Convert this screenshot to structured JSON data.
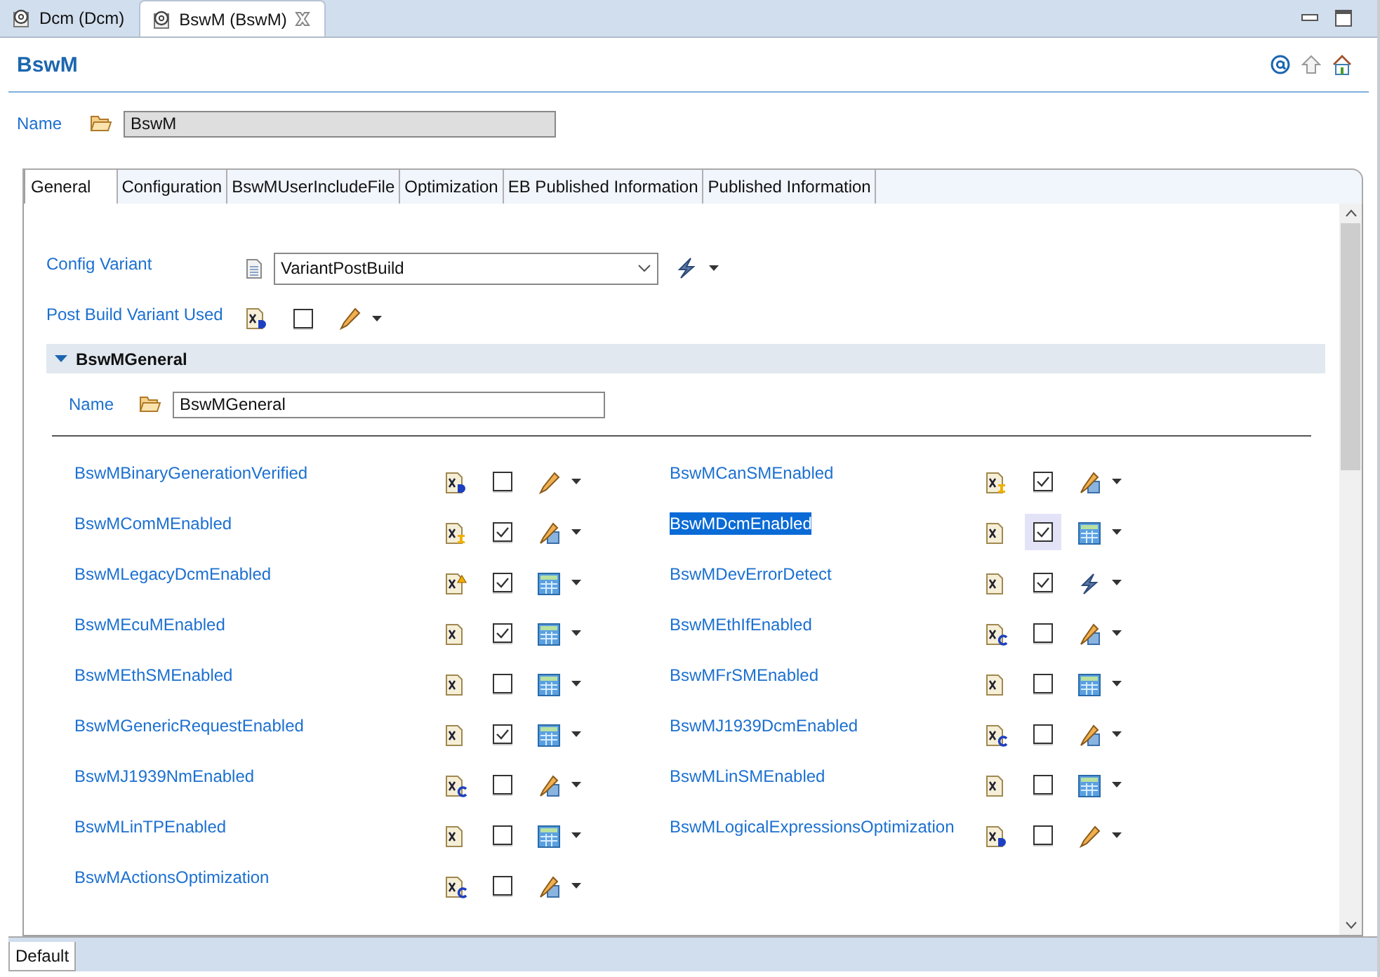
{
  "editor_tabs": [
    {
      "label": "Dcm (Dcm)",
      "selected": false,
      "closable": false
    },
    {
      "label": "BswM (BswM)",
      "selected": true,
      "closable": true
    }
  ],
  "title": "BswM",
  "name_field": {
    "label": "Name",
    "value": "BswM"
  },
  "tabs": [
    {
      "label": "General",
      "selected": true
    },
    {
      "label": "Configuration",
      "selected": false
    },
    {
      "label": "BswMUserIncludeFile",
      "selected": false
    },
    {
      "label": "Optimization",
      "selected": false
    },
    {
      "label": "EB Published Information",
      "selected": false
    },
    {
      "label": "Published Information",
      "selected": false
    }
  ],
  "config_variant": {
    "label": "Config Variant",
    "value": "VariantPostBuild"
  },
  "post_build": {
    "label": "Post Build Variant Used",
    "checked": false
  },
  "section": {
    "title": "BswMGeneral",
    "expanded": true,
    "name_label": "Name",
    "name_value": "BswMGeneral"
  },
  "parameters": [
    {
      "name": "BswMBinaryGenerationVerified",
      "badge": {
        "kind": "d"
      },
      "checked": false,
      "mode": {
        "kind": "pencil"
      },
      "selected": false
    },
    {
      "name": "BswMCanSMEnabled",
      "badge": {
        "kind": "i"
      },
      "checked": true,
      "mode": {
        "kind": "calc"
      },
      "selected": false
    },
    {
      "name": "BswMComMEnabled",
      "badge": {
        "kind": "i"
      },
      "checked": true,
      "mode": {
        "kind": "calc"
      },
      "selected": false
    },
    {
      "name": "BswMDcmEnabled",
      "badge": {
        "kind": "x"
      },
      "checked": true,
      "mode": {
        "kind": "table"
      },
      "selected": true
    },
    {
      "name": "BswMLegacyDcmEnabled",
      "badge": {
        "kind": "w"
      },
      "checked": true,
      "mode": {
        "kind": "table"
      },
      "selected": false
    },
    {
      "name": "BswMDevErrorDetect",
      "badge": {
        "kind": "x"
      },
      "checked": true,
      "mode": {
        "kind": "link"
      },
      "selected": false
    },
    {
      "name": "BswMEcuMEnabled",
      "badge": {
        "kind": "x"
      },
      "checked": true,
      "mode": {
        "kind": "table"
      },
      "selected": false
    },
    {
      "name": "BswMEthIfEnabled",
      "badge": {
        "kind": "c"
      },
      "checked": false,
      "mode": {
        "kind": "calc"
      },
      "selected": false
    },
    {
      "name": "BswMEthSMEnabled",
      "badge": {
        "kind": "x"
      },
      "checked": false,
      "mode": {
        "kind": "table"
      },
      "selected": false
    },
    {
      "name": "BswMFrSMEnabled",
      "badge": {
        "kind": "x"
      },
      "checked": false,
      "mode": {
        "kind": "table"
      },
      "selected": false
    },
    {
      "name": "BswMGenericRequestEnabled",
      "badge": {
        "kind": "x"
      },
      "checked": true,
      "mode": {
        "kind": "table"
      },
      "selected": false
    },
    {
      "name": "BswMJ1939DcmEnabled",
      "badge": {
        "kind": "c"
      },
      "checked": false,
      "mode": {
        "kind": "calc"
      },
      "selected": false
    },
    {
      "name": "BswMJ1939NmEnabled",
      "badge": {
        "kind": "c"
      },
      "checked": false,
      "mode": {
        "kind": "calc"
      },
      "selected": false
    },
    {
      "name": "BswMLinSMEnabled",
      "badge": {
        "kind": "x"
      },
      "checked": false,
      "mode": {
        "kind": "table"
      },
      "selected": false
    },
    {
      "name": "BswMLinTPEnabled",
      "badge": {
        "kind": "x"
      },
      "checked": false,
      "mode": {
        "kind": "table"
      },
      "selected": false
    },
    {
      "name": "BswMLogicalExpressionsOptimization",
      "badge": {
        "kind": "d"
      },
      "checked": false,
      "mode": {
        "kind": "pencil"
      },
      "selected": false
    },
    {
      "name": "BswMActionsOptimization",
      "badge": {
        "kind": "c"
      },
      "checked": false,
      "mode": {
        "kind": "calc"
      },
      "selected": false
    }
  ],
  "bottom_tabs": [
    {
      "label": "Default"
    }
  ]
}
